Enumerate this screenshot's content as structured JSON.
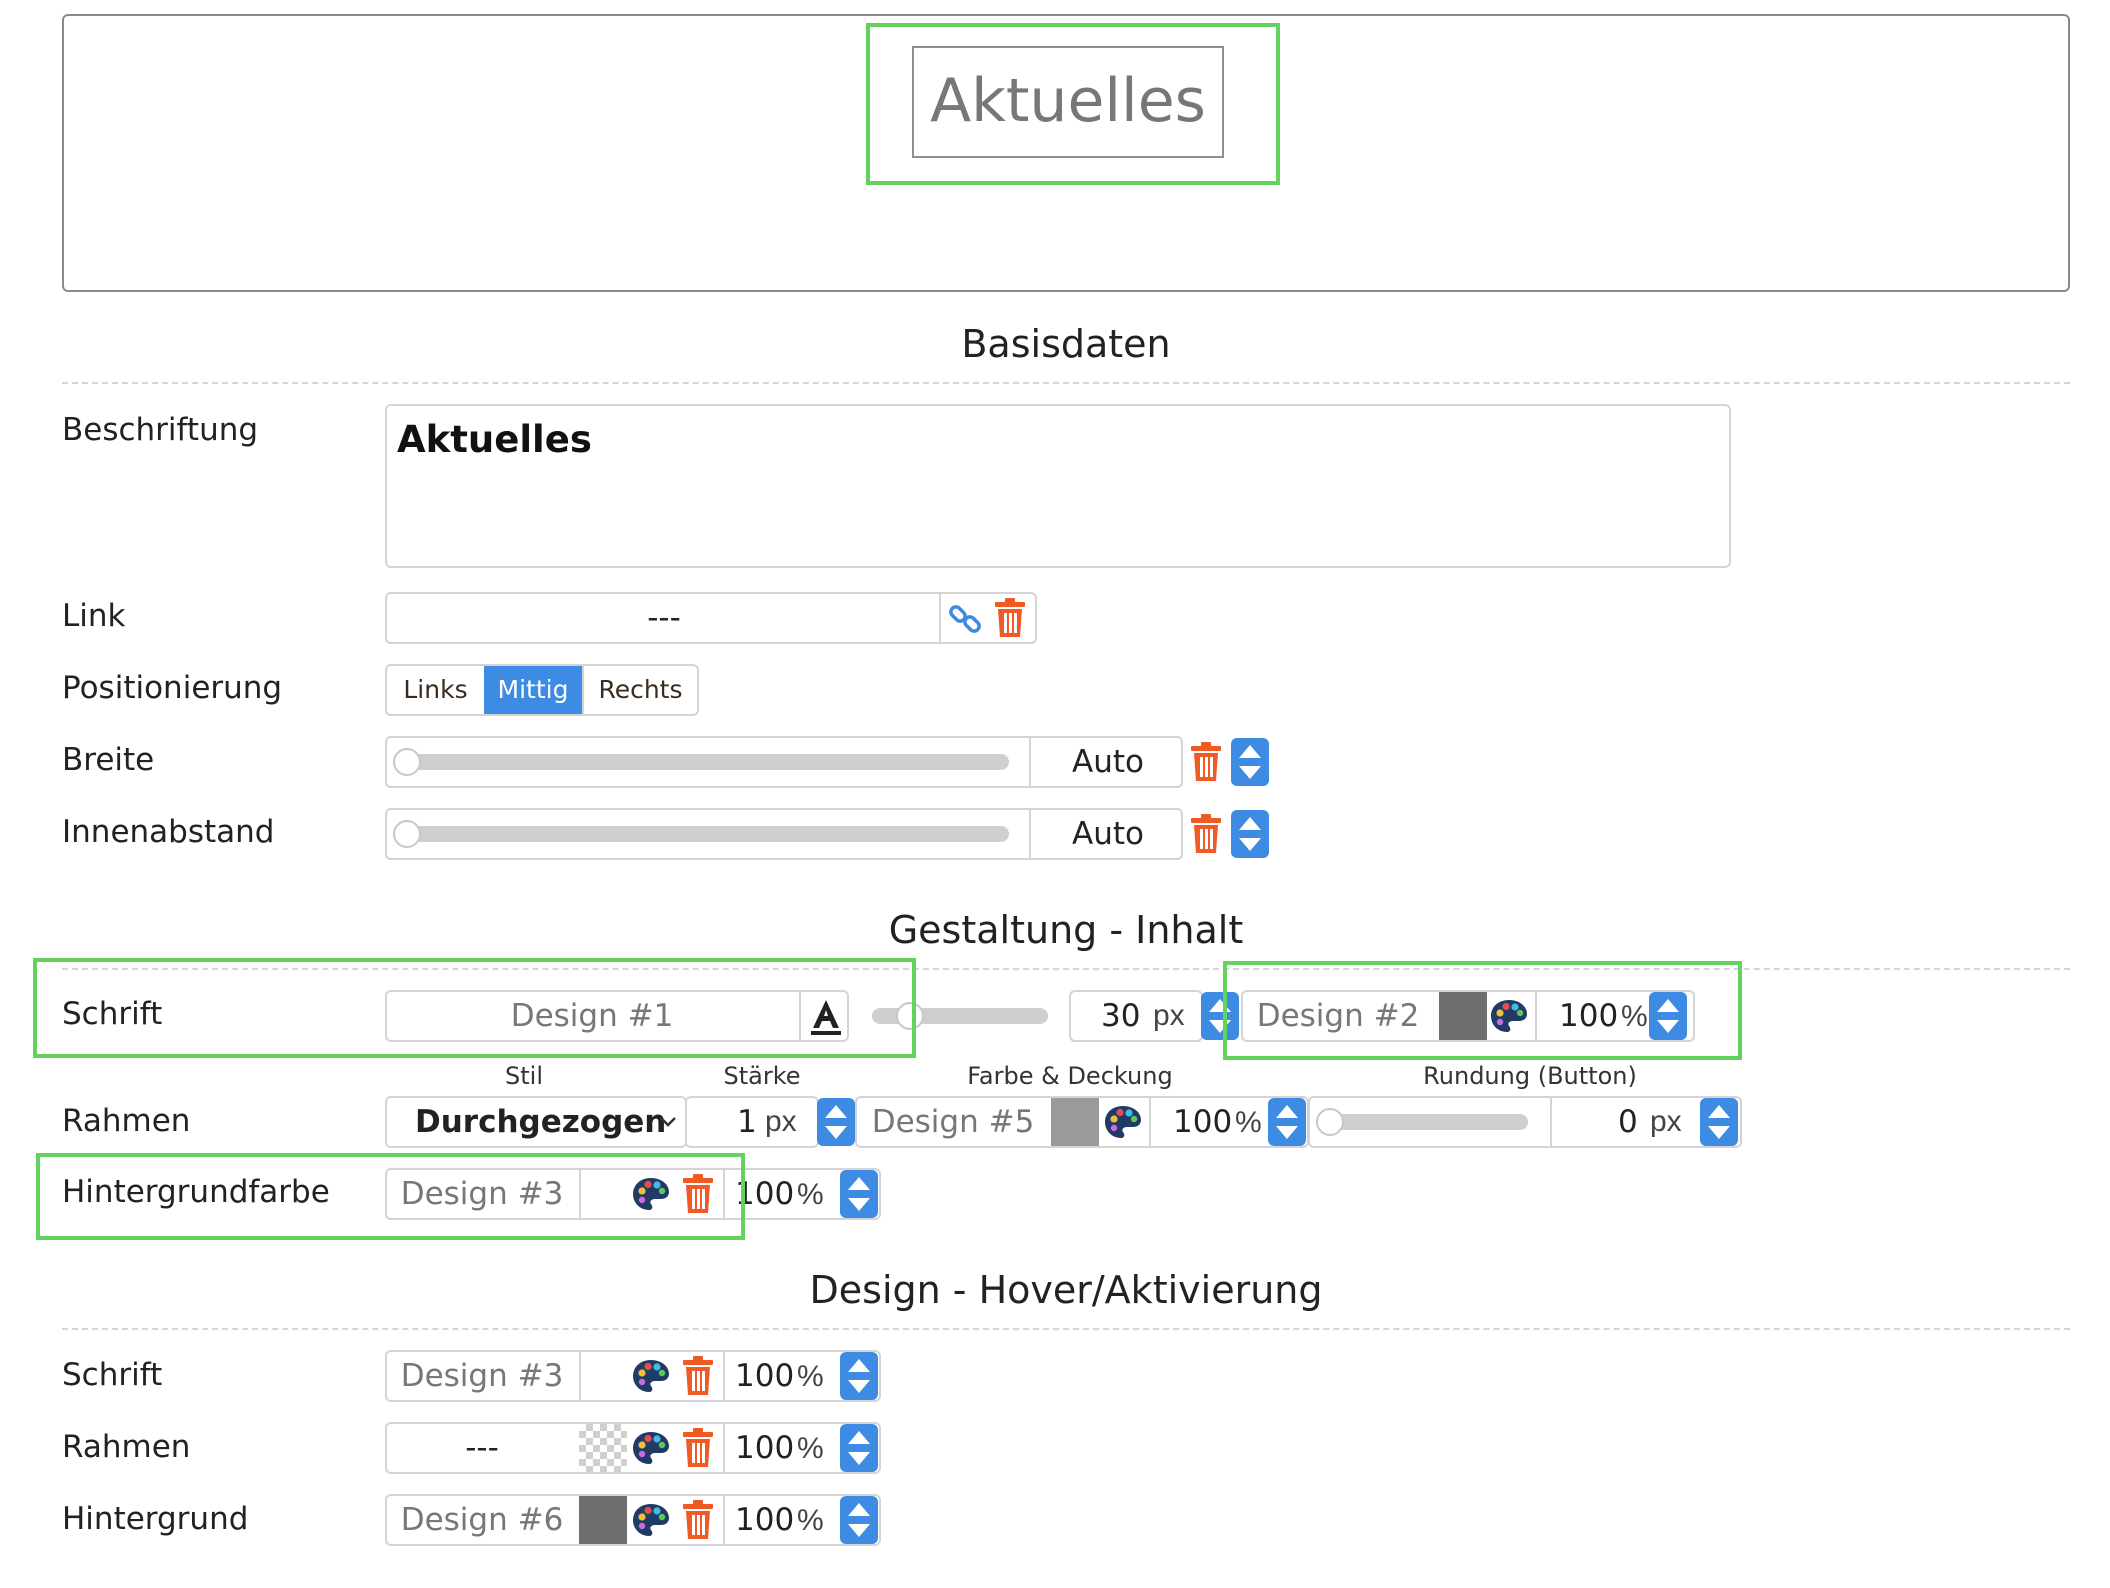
{
  "preview": {
    "button_text": "Aktuelles"
  },
  "sections": {
    "basis": "Basisdaten",
    "inhalt": "Gestaltung - Inhalt",
    "hover": "Design - Hover/Aktivierung"
  },
  "basis": {
    "beschriftung": {
      "label": "Beschriftung",
      "value": "Aktuelles"
    },
    "link": {
      "label": "Link",
      "value": "---"
    },
    "positionierung": {
      "label": "Positionierung",
      "options": [
        "Links",
        "Mittig",
        "Rechts"
      ],
      "selected": "Mittig"
    },
    "breite": {
      "label": "Breite",
      "value": "Auto"
    },
    "innenabstand": {
      "label": "Innenabstand",
      "value": "Auto"
    }
  },
  "inhalt": {
    "schrift": {
      "label": "Schrift",
      "design": "Design #1",
      "size": "30",
      "size_unit": "px",
      "color_design": "Design #2",
      "opacity": "100",
      "opacity_unit": "%"
    },
    "rahmen_headers": {
      "stil": "Stil",
      "staerke": "Stärke",
      "farbe": "Farbe & Deckung",
      "rundung": "Rundung (Button)"
    },
    "rahmen": {
      "label": "Rahmen",
      "stil": "Durchgezogen",
      "staerke": "1",
      "staerke_unit": "px",
      "color_design": "Design #5",
      "opacity": "100",
      "opacity_unit": "%",
      "rundung": "0",
      "rundung_unit": "px"
    },
    "hintergrund": {
      "label": "Hintergrundfarbe",
      "design": "Design #3",
      "opacity": "100",
      "opacity_unit": "%"
    }
  },
  "hover": {
    "schrift": {
      "label": "Schrift",
      "design": "Design #3",
      "opacity": "100",
      "opacity_unit": "%"
    },
    "rahmen": {
      "label": "Rahmen",
      "design": "---",
      "opacity": "100",
      "opacity_unit": "%"
    },
    "hintergrund": {
      "label": "Hintergrund",
      "design": "Design #6",
      "opacity": "100",
      "opacity_unit": "%"
    }
  },
  "colors": {
    "accent": "#3d8be3",
    "highlight": "#63d35e",
    "trash": "#f05a24",
    "swatch_dark": "#6e6e6e",
    "swatch_mid": "#9a9a9a"
  }
}
